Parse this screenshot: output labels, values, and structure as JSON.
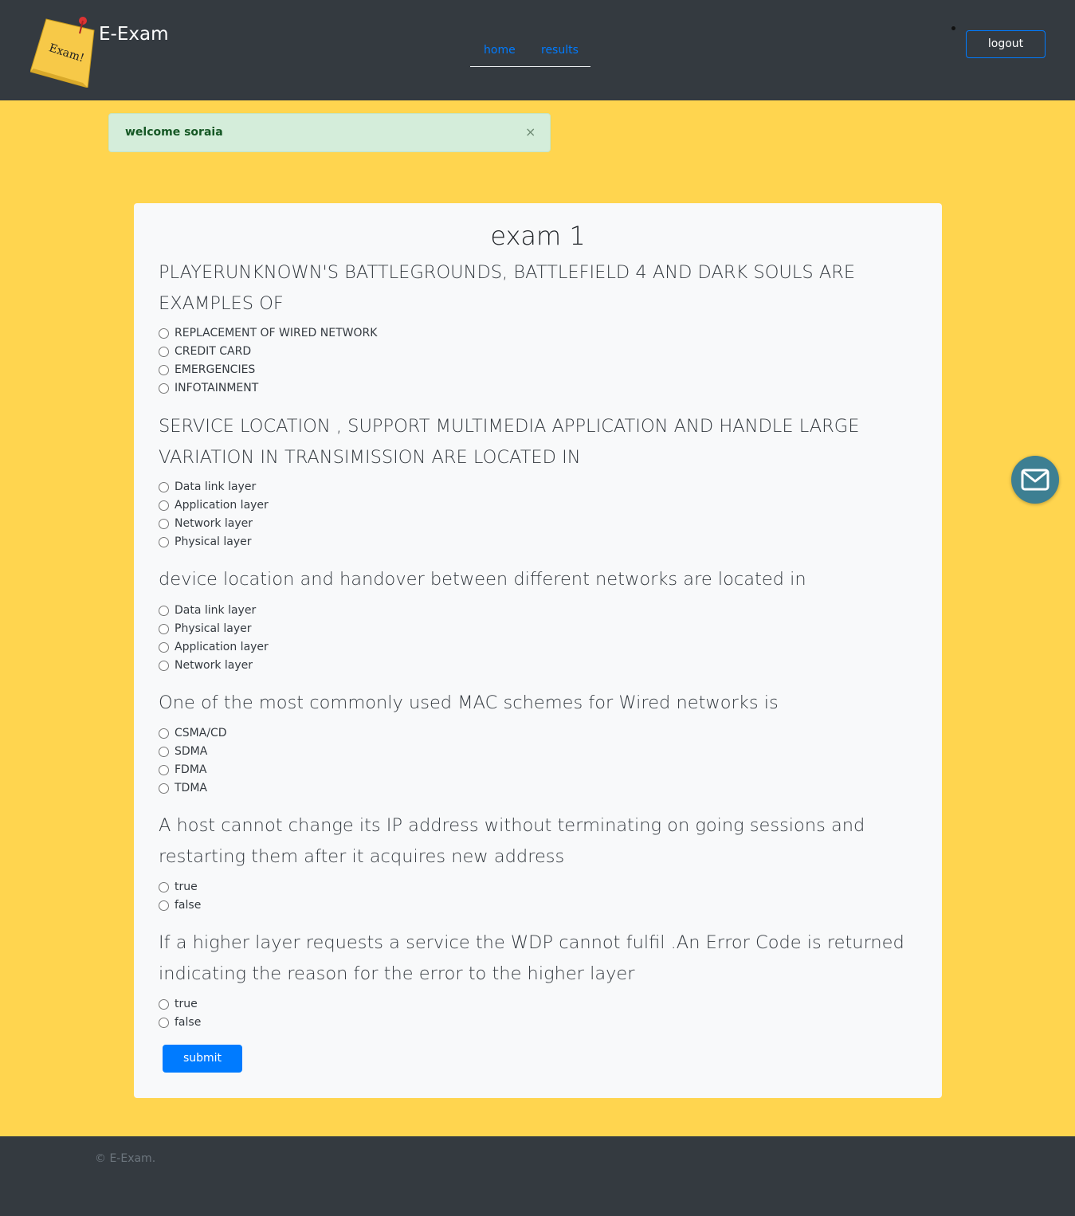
{
  "header": {
    "brand": "E-Exam",
    "logo_text": "Exam!",
    "nav": {
      "home": "home",
      "results": "results"
    },
    "logout": "logout"
  },
  "alert": {
    "message": "welcome soraia",
    "close": "×"
  },
  "exam": {
    "title": "exam 1",
    "questions": [
      {
        "text": "PLAYERUNKNOWN'S BATTLEGROUNDS, BATTLEFIELD 4 AND DARK SOULS ARE EXAMPLES OF",
        "options": [
          "REPLACEMENT OF WIRED NETWORK",
          "CREDIT CARD",
          "EMERGENCIES",
          "INFOTAINMENT"
        ]
      },
      {
        "text": "SERVICE LOCATION , SUPPORT MULTIMEDIA APPLICATION AND HANDLE LARGE VARIATION IN TRANSIMISSION ARE LOCATED IN",
        "options": [
          "Data link layer",
          "Application layer",
          "Network layer",
          "Physical layer"
        ]
      },
      {
        "text": "device location and handover between different networks are located in",
        "options": [
          "Data link layer",
          "Physical layer",
          "Application layer",
          "Network layer"
        ]
      },
      {
        "text": "One of the most commonly used MAC schemes for Wired networks is",
        "options": [
          "CSMA/CD",
          "SDMA",
          "FDMA",
          "TDMA"
        ]
      },
      {
        "text": "A host cannot change its IP address without terminating on going sessions and restarting them after it acquires new address",
        "options": [
          "true",
          "false"
        ]
      },
      {
        "text": "If a higher layer requests a service the WDP cannot fulfil .An Error Code is returned indicating the reason for the error to the higher layer",
        "options": [
          "true",
          "false"
        ]
      }
    ],
    "submit": "submit"
  },
  "footer": {
    "copyright": "© E-Exam."
  },
  "colors": {
    "page_bg": "#ffd54f",
    "header_bg": "#343a40",
    "primary": "#007bff",
    "alert_bg": "#d4edda",
    "mail_button": "#3d7f92"
  },
  "icons": {
    "mail": "envelope-icon",
    "logo": "sticky-note-logo"
  }
}
